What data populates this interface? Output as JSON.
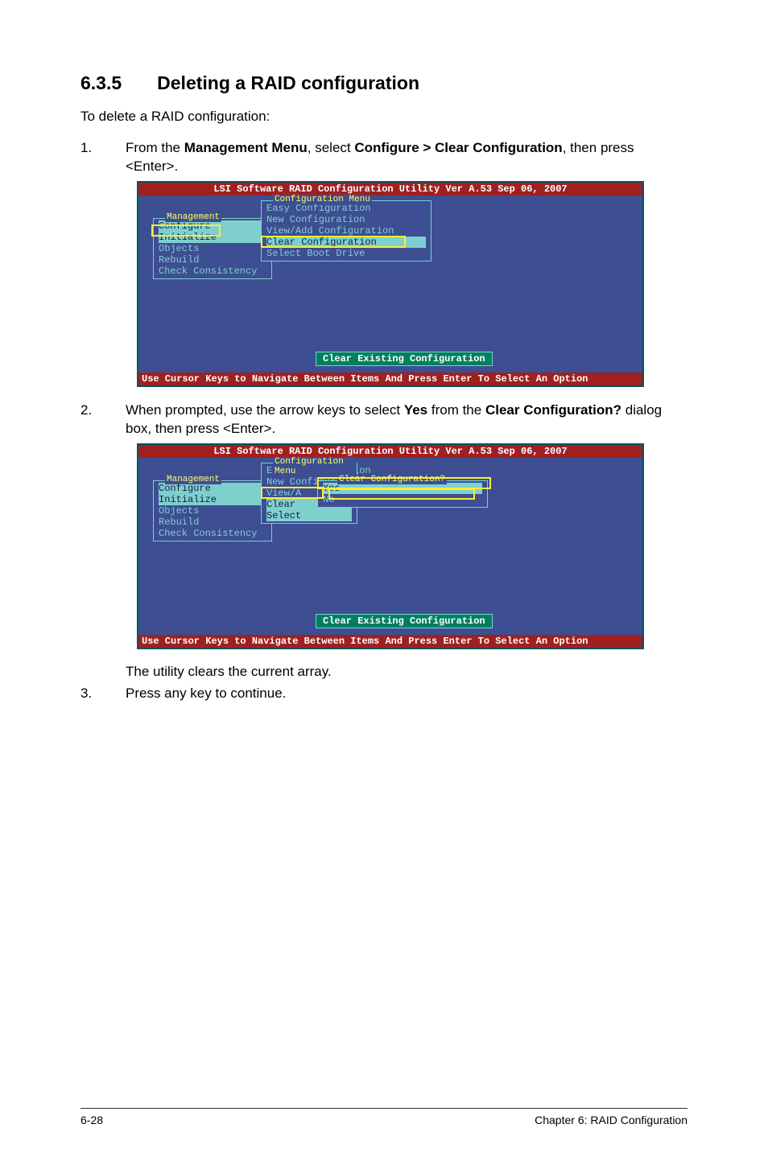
{
  "section": {
    "number": "6.3.5",
    "title": "Deleting a RAID configuration"
  },
  "intro": "To delete a RAID configuration:",
  "steps": {
    "s1_num": "1.",
    "s1_pre": "From the ",
    "s1_b1": "Management Menu",
    "s1_mid": ", select ",
    "s1_b2": "Configure > Clear Configuration",
    "s1_post": ", then press <Enter>.",
    "s2_num": "2.",
    "s2_pre": "When prompted, use the arrow keys to select ",
    "s2_b1": "Yes",
    "s2_mid": " from the ",
    "s2_b2": "Clear Configuration?",
    "s2_post": " dialog box, then press <Enter>.",
    "s3_num": "3.",
    "s3_text": "Press any key to continue."
  },
  "indent_para": "The utility clears the current array.",
  "screenshot": {
    "titlebar": "LSI Software RAID Configuration Utility Ver A.53 Sep 06, 2007",
    "bottombar": "Use Cursor Keys to Navigate Between Items And Press Enter To Select An Option",
    "mgmt_title": "Management",
    "mgmt_items": {
      "configure": "Configure",
      "initialize": "Initialize",
      "objects": "Objects",
      "rebuild": "Rebuild",
      "check": "Check Consistency"
    },
    "config_title": "Configuration Menu",
    "config_items": {
      "easy": "Easy Configuration",
      "new": "New Configuration",
      "viewadd": "View/Add Configuration",
      "clear": "Clear Configuration",
      "select_boot": "Select Boot Drive",
      "viewadd_trunc": "View/A",
      "clear_trunc": "Clear",
      "select_trunc": "Select"
    },
    "status_text": "Clear Existing Configuration",
    "dialog_title": "Clear Configuration?",
    "dialog_yes": "Yes",
    "dialog_no": "No"
  },
  "footer": {
    "left": "6-28",
    "right": "Chapter 6: RAID Configuration"
  }
}
